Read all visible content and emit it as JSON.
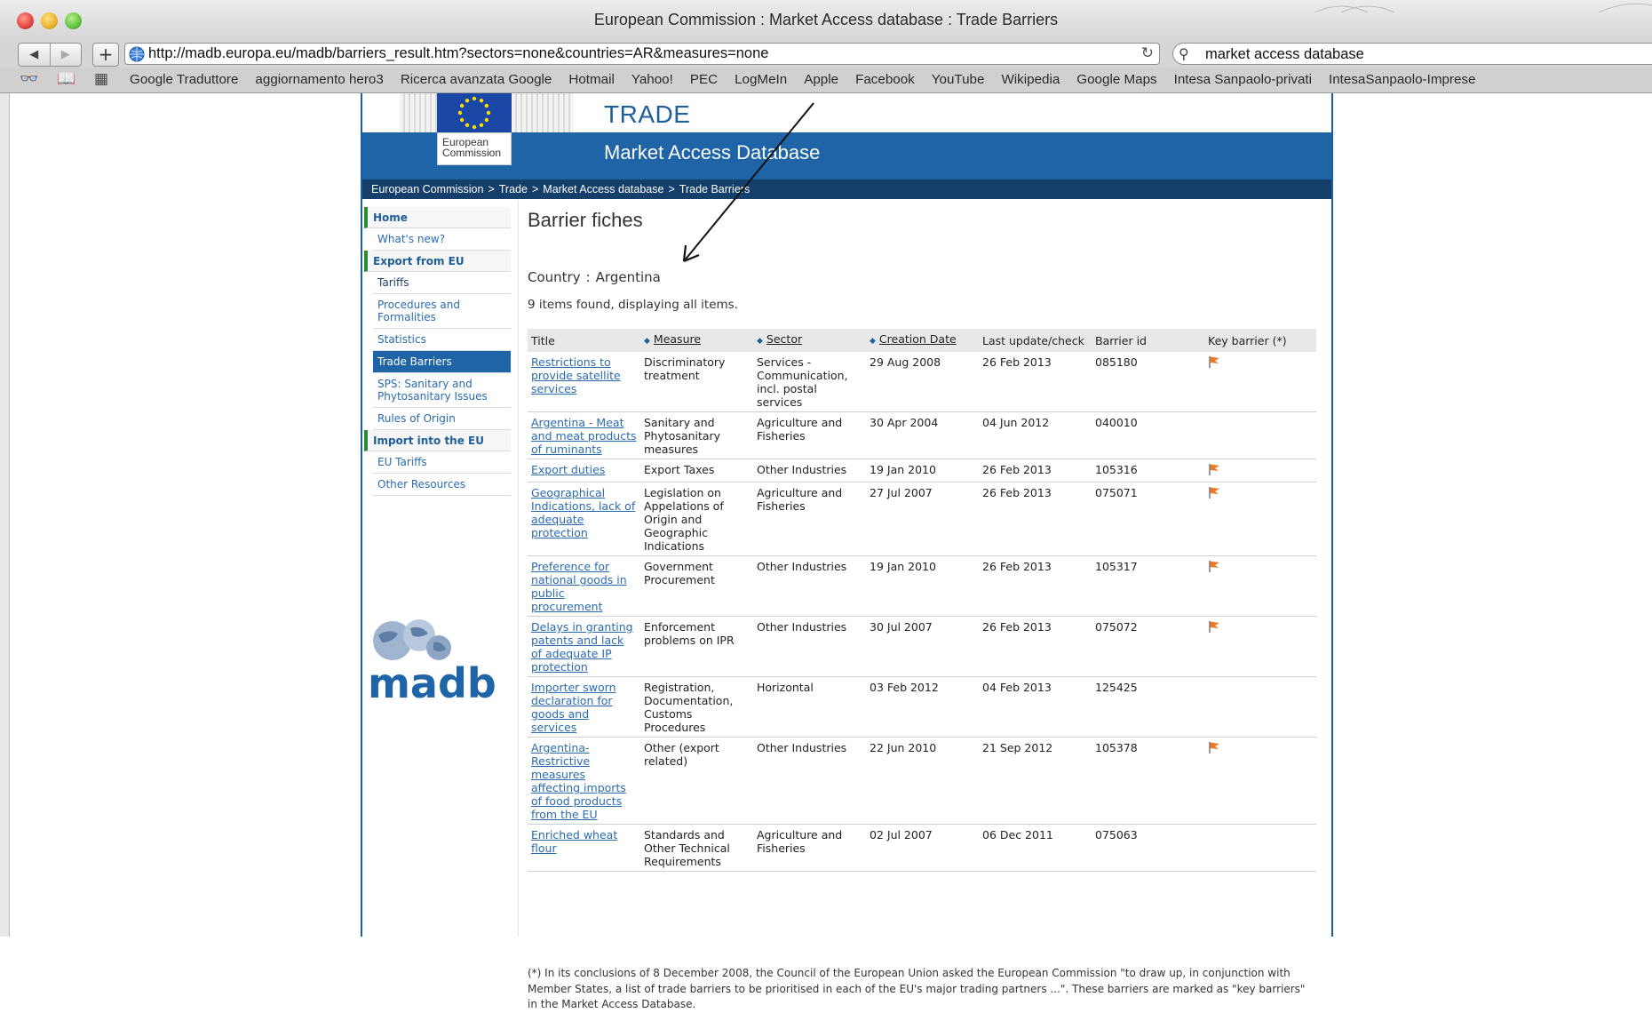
{
  "window": {
    "title": "European Commission : Market Access database : Trade Barriers"
  },
  "toolbar": {
    "back": "◀",
    "forward": "▶",
    "new_tab": "+",
    "url": "http://madb.europa.eu/madb/barriers_result.htm?sectors=none&countries=AR&measures=none",
    "reload": "↻",
    "search_value": "market access database"
  },
  "bookmarks": [
    "Google Traduttore",
    "aggiornamento hero3",
    "Ricerca avanzata Google",
    "Hotmail",
    "Yahoo!",
    "PEC",
    "LogMeIn",
    "Apple",
    "Facebook",
    "YouTube",
    "Wikipedia",
    "Google Maps",
    "Intesa Sanpaolo-privati",
    "IntesaSanpaolo-Imprese"
  ],
  "header": {
    "eu_label_line1": "European",
    "eu_label_line2": "Commission",
    "trade": "TRADE",
    "db_title": "Market Access Database"
  },
  "breadcrumb": [
    "European Commission",
    "Trade",
    "Market Access database",
    "Trade Barriers"
  ],
  "breadcrumb_sep": ">",
  "nav": {
    "home": "Home",
    "whats_new": "What's new?",
    "export": "Export from EU",
    "tariffs": "Tariffs",
    "procedures": "Procedures and Formalities",
    "statistics": "Statistics",
    "trade_barriers": "Trade Barriers",
    "sps": "SPS: Sanitary and Phytosanitary Issues",
    "rules": "Rules of Origin",
    "import": "Import into the EU",
    "eu_tariffs": "EU Tariffs",
    "other": "Other Resources"
  },
  "logo_text": "madb",
  "main": {
    "title": "Barrier fiches",
    "country_label": "Country",
    "country_sep": ":",
    "country_value": "Argentina",
    "found": "9 items found, displaying all items."
  },
  "table": {
    "headers": {
      "title": "Title",
      "measure": "Measure",
      "sector": "Sector",
      "creation": "Creation Date",
      "update": "Last update/check",
      "id": "Barrier id",
      "key": "Key barrier (*)"
    },
    "rows": [
      {
        "title": "Restrictions to provide satellite services",
        "measure": "Discriminatory treatment",
        "sector": "Services - Communication, incl. postal services",
        "created": "29 Aug 2008",
        "updated": "26 Feb 2013",
        "id": "085180",
        "key": true
      },
      {
        "title": "Argentina - Meat and meat products of ruminants",
        "measure": "Sanitary and Phytosanitary measures",
        "sector": "Agriculture and Fisheries",
        "created": "30 Apr 2004",
        "updated": "04 Jun 2012",
        "id": "040010",
        "key": false
      },
      {
        "title": "Export duties",
        "measure": "Export Taxes",
        "sector": "Other Industries",
        "created": "19 Jan 2010",
        "updated": "26 Feb 2013",
        "id": "105316",
        "key": true
      },
      {
        "title": "Geographical Indications, lack of adequate protection",
        "measure": "Legislation on Appelations of Origin and Geographic Indications",
        "sector": "Agriculture and Fisheries",
        "created": "27 Jul 2007",
        "updated": "26 Feb 2013",
        "id": "075071",
        "key": true
      },
      {
        "title": "Preference for national goods in public procurement",
        "measure": "Government Procurement",
        "sector": "Other Industries",
        "created": "19 Jan 2010",
        "updated": "26 Feb 2013",
        "id": "105317",
        "key": true
      },
      {
        "title": "Delays in granting patents and lack of adequate IP protection",
        "measure": "Enforcement problems on IPR",
        "sector": "Other Industries",
        "created": "30 Jul 2007",
        "updated": "26 Feb 2013",
        "id": "075072",
        "key": true
      },
      {
        "title": "Importer sworn declaration for goods and services",
        "measure": "Registration, Documentation, Customs Procedures",
        "sector": "Horizontal",
        "created": "03 Feb 2012",
        "updated": "04 Feb 2013",
        "id": "125425",
        "key": false
      },
      {
        "title": "Argentina- Restrictive measures affecting imports of food products from the EU",
        "measure": "Other (export related)",
        "sector": "Other Industries",
        "created": "22 Jun 2010",
        "updated": "21 Sep 2012",
        "id": "105378",
        "key": true
      },
      {
        "title": "Enriched wheat flour",
        "measure": "Standards and Other Technical Requirements",
        "sector": "Agriculture and Fisheries",
        "created": "02 Jul 2007",
        "updated": "06 Dec 2011",
        "id": "075063",
        "key": false
      }
    ]
  },
  "footnote": "(*) In its conclusions of 8 December 2008, the Council of the European Union asked the European Commission \"to draw up, in conjunction with Member States, a list of trade barriers to be prioritised in each of the EU's major trading partners ...\". These barriers are marked as \"key barriers\" in the Market Access Database.",
  "colors": {
    "eu_blue": "#1e64a7",
    "dark_blue": "#143f6b",
    "link": "#2a6bb0",
    "nav_green": "#2a8a35",
    "key_flag": "#e87a2a"
  }
}
